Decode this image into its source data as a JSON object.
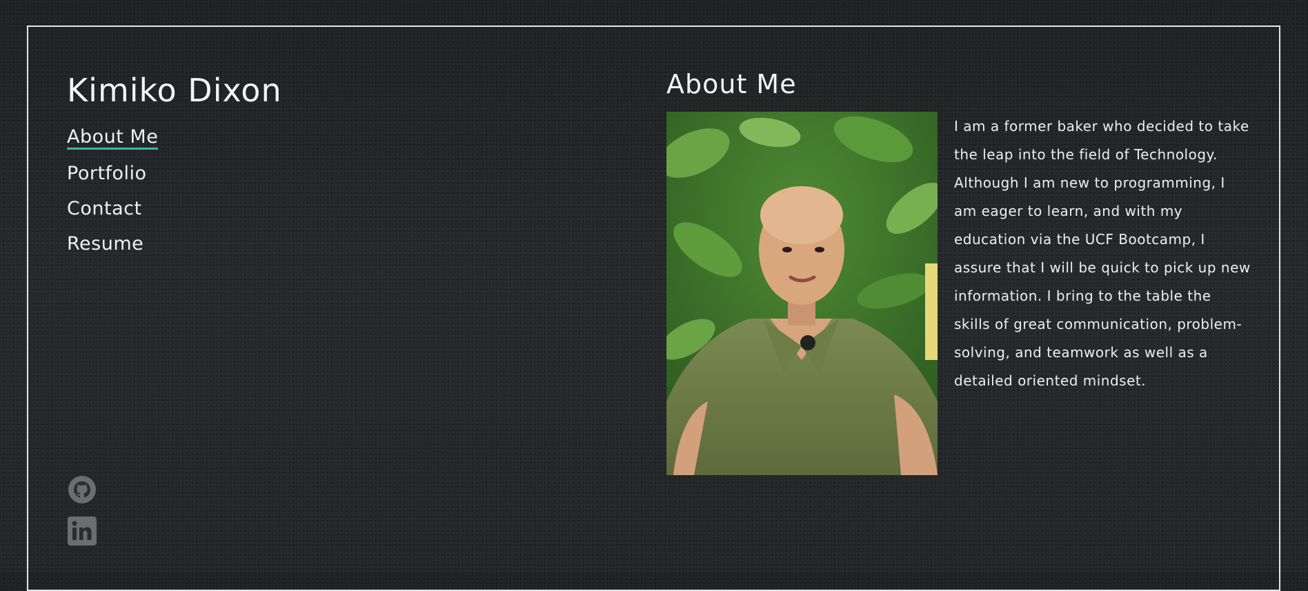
{
  "site": {
    "name": "Kimiko Dixon"
  },
  "nav": {
    "items": [
      {
        "label": "About Me",
        "active": true
      },
      {
        "label": "Portfolio",
        "active": false
      },
      {
        "label": "Contact",
        "active": false
      },
      {
        "label": "Resume",
        "active": false
      }
    ]
  },
  "social": {
    "github_icon": "github-icon",
    "linkedin_icon": "linkedin-icon"
  },
  "about": {
    "title": "About Me",
    "bio": "I am a former baker who decided to take the leap into the field of Technology. Although I am new to programming, I am eager to learn, and with my education via the UCF Bootcamp, I assure that I will be quick to pick up new information. I bring to the table the skills of great communication, problem-solving, and teamwork as well as a detailed oriented mindset."
  },
  "colors": {
    "accent": "#3bb9a0",
    "background": "#242628",
    "frame": "#e6e6e6",
    "icon": "#6b6d6f"
  }
}
